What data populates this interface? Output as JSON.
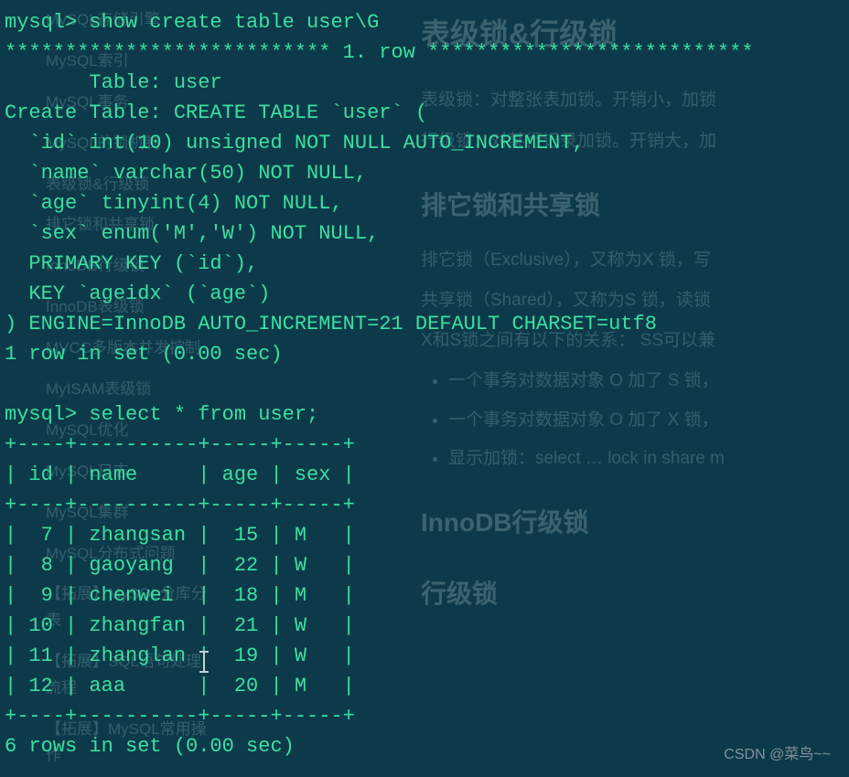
{
  "terminal": {
    "prompt1": "mysql> show create table user\\G",
    "row_header": "*************************** 1. row ***************************",
    "table_line": "       Table: user",
    "create_line": "Create Table: CREATE TABLE `user` (",
    "col_id": "  `id` int(10) unsigned NOT NULL AUTO_INCREMENT,",
    "col_name": "  `name` varchar(50) NOT NULL,",
    "col_age": "  `age` tinyint(4) NOT NULL,",
    "col_sex": "  `sex` enum('M','W') NOT NULL,",
    "pk": "  PRIMARY KEY (`id`),",
    "key": "  KEY `ageidx` (`age`)",
    "engine": ") ENGINE=InnoDB AUTO_INCREMENT=21 DEFAULT CHARSET=utf8",
    "result1": "1 row in set (0.00 sec)",
    "blank": "",
    "prompt2": "mysql> select * from user;",
    "sep": "+----+----------+-----+-----+",
    "header": "| id | name     | age | sex |",
    "rows": [
      "|  7 | zhangsan |  15 | M   |",
      "|  8 | gaoyang  |  22 | W   |",
      "|  9 | chenwei  |  18 | M   |",
      "| 10 | zhangfan |  21 | W   |",
      "| 11 | zhanglan |  19 | W   |",
      "| 12 | aaa      |  20 | M   |"
    ],
    "result2": "6 rows in set (0.00 sec)"
  },
  "bg": {
    "sidebar": [
      "MySQL存储引擎",
      "MySQL索引",
      "MySQL事务",
      "MySQL的锁机制",
      "表级锁&行级锁",
      "排它锁和共享锁",
      "InnoDB行级锁",
      "InnoDB表级锁",
      "MVCC多版本并发控制",
      "MyISAM表级锁",
      "MySQL优化",
      "MySQL日志",
      "MySQL集群",
      "MySQL分布式问题",
      "【拓展】MySQL分库分表",
      "【拓展】SQL语句处理流程",
      "【拓展】MySQL常用操作"
    ],
    "content": {
      "h1": "表级锁&行级锁",
      "p1": "表级锁：对整张表加锁。开销小，加锁",
      "p2": "行级锁：对某行记录加锁。开销大，加",
      "h2a": "排它锁和共享锁",
      "p3": "排它锁（Exclusive），又称为X 锁，写",
      "p4": "共享锁（Shared），又称为S 锁，读锁",
      "p5": "X和S锁之间有以下的关系：  SS可以兼",
      "li1": "一个事务对数据对象 O 加了 S 锁，",
      "li2": "一个事务对数据对象 O 加了 X 锁，",
      "li3": "显示加锁：select … lock in share m",
      "h2b": "InnoDB行级锁",
      "h3": "行级锁"
    }
  },
  "watermark": "CSDN @菜鸟~~",
  "table_data": {
    "columns": [
      "id",
      "name",
      "age",
      "sex"
    ],
    "rows": [
      {
        "id": 7,
        "name": "zhangsan",
        "age": 15,
        "sex": "M"
      },
      {
        "id": 8,
        "name": "gaoyang",
        "age": 22,
        "sex": "W"
      },
      {
        "id": 9,
        "name": "chenwei",
        "age": 18,
        "sex": "M"
      },
      {
        "id": 10,
        "name": "zhangfan",
        "age": 21,
        "sex": "W"
      },
      {
        "id": 11,
        "name": "zhanglan",
        "age": 19,
        "sex": "W"
      },
      {
        "id": 12,
        "name": "aaa",
        "age": 20,
        "sex": "M"
      }
    ]
  }
}
